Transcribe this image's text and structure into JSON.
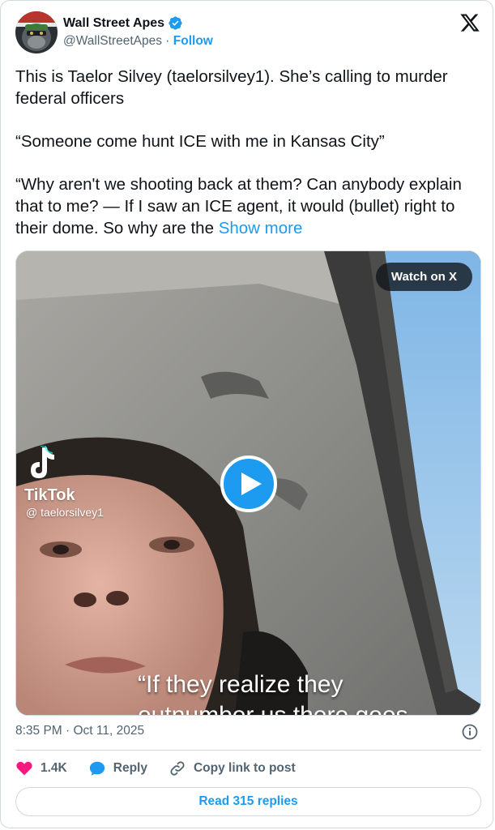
{
  "author": {
    "name": "Wall Street Apes",
    "handle": "@WallStreetApes",
    "separator": "·",
    "follow_label": "Follow"
  },
  "tweet": {
    "paragraphs": [
      "This is Taelor Silvey (taelorsilvey1). She’s calling to murder federal officers",
      "“Someone come hunt ICE with me in Kansas City”",
      "“Why aren't we shooting back at them? Can anybody explain that to me?  — If I saw an ICE agent, it would (bullet) right to their dome. So why are the"
    ],
    "show_more": "Show more"
  },
  "media": {
    "watch_label": "Watch on X",
    "tiktok_brand": "TikTok",
    "tiktok_user": "@ taelorsilvey1",
    "caption_line1": "“If they realize they",
    "caption_line2": "outnumber us there goes"
  },
  "meta": {
    "timestamp": "8:35 PM · Oct 11, 2025"
  },
  "actions": {
    "like_count": "1.4K",
    "reply_label": "Reply",
    "copy_label": "Copy link to post"
  },
  "footer": {
    "read_replies": "Read 315 replies"
  },
  "colors": {
    "accent": "#1d9bf0",
    "like": "#f91880",
    "secondary_text": "#536471",
    "border": "#cfd9de"
  }
}
